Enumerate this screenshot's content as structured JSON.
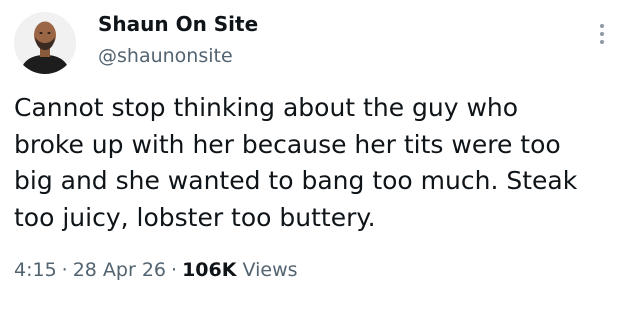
{
  "author": {
    "display_name": "Shaun On Site",
    "handle": "@shaunonsite",
    "avatar_icon": "person-avatar-icon"
  },
  "tweet": {
    "lines": [
      "Cannot stop thinking about the guy who",
      "broke up with her because her tits were too",
      "big and she wanted to bang too much. Steak",
      "too juicy, lobster too buttery."
    ]
  },
  "meta": {
    "time": "4:15",
    "date": "28 Apr 26",
    "views_count": "106K",
    "views_label": "Views",
    "separator": "·"
  },
  "colors": {
    "text_primary": "#0f1419",
    "text_secondary": "#536471"
  }
}
